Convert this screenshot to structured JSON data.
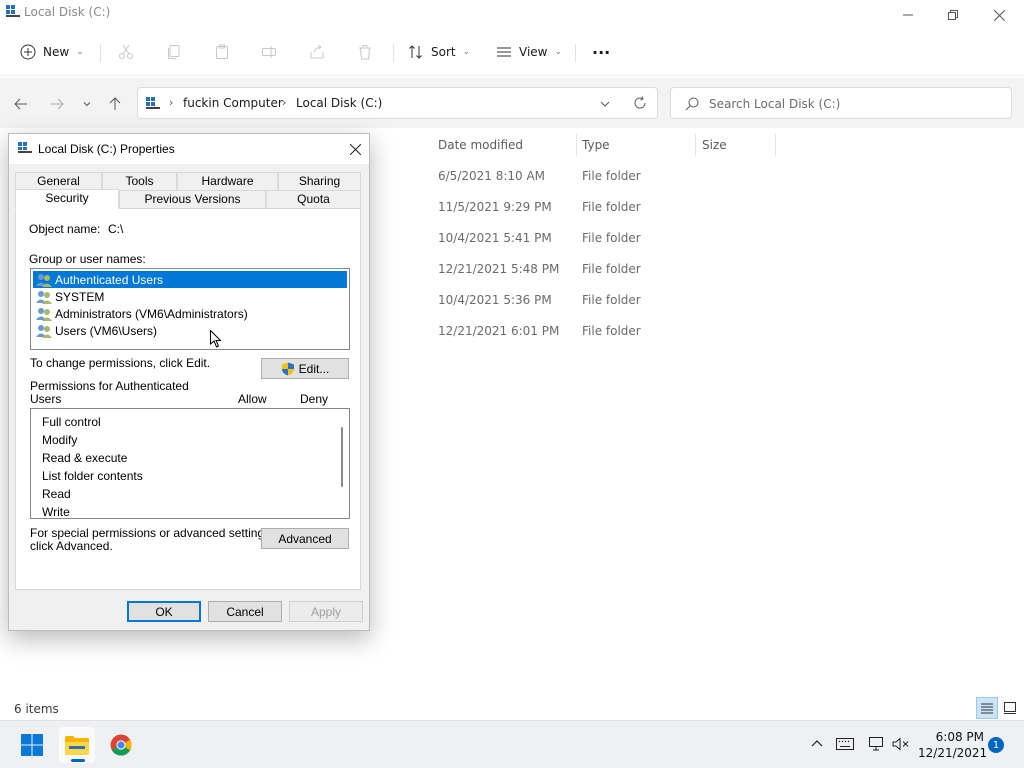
{
  "explorer": {
    "title": "Local Disk (C:)",
    "toolbar": {
      "new_label": "New",
      "sort_label": "Sort",
      "view_label": "View",
      "more_label": "···"
    },
    "address": {
      "root": "fuckin Computer",
      "current": "Local Disk (C:)"
    },
    "search": {
      "placeholder": "Search Local Disk (C:)"
    },
    "columns": {
      "date": "Date modified",
      "type": "Type",
      "size": "Size"
    },
    "files": [
      {
        "date": "6/5/2021 8:10 AM",
        "type": "File folder"
      },
      {
        "date": "11/5/2021 9:29 PM",
        "type": "File folder"
      },
      {
        "date": "10/4/2021 5:41 PM",
        "type": "File folder"
      },
      {
        "date": "12/21/2021 5:48 PM",
        "type": "File folder"
      },
      {
        "date": "10/4/2021 5:36 PM",
        "type": "File folder"
      },
      {
        "date": "12/21/2021 6:01 PM",
        "type": "File folder"
      }
    ],
    "status": {
      "item_count": "6 items"
    }
  },
  "dialog": {
    "title": "Local Disk (C:) Properties",
    "tabs_row1": [
      "General",
      "Tools",
      "Hardware",
      "Sharing"
    ],
    "tabs_row2": [
      "Security",
      "Previous Versions",
      "Quota"
    ],
    "active_tab": "Security",
    "object_name_label": "Object name:",
    "object_name_value": "C:\\",
    "group_label": "Group or user names:",
    "groups": [
      "Authenticated Users",
      "SYSTEM",
      "Administrators (VM6\\Administrators)",
      "Users (VM6\\Users)"
    ],
    "selected_group": "Authenticated Users",
    "change_text": "To change permissions, click Edit.",
    "edit_label": "Edit...",
    "permissions_label_line1": "Permissions for Authenticated",
    "permissions_label_line2": "Users",
    "allow_label": "Allow",
    "deny_label": "Deny",
    "permissions": [
      "Full control",
      "Modify",
      "Read & execute",
      "List folder contents",
      "Read",
      "Write"
    ],
    "advanced_text_line1": "For special permissions or advanced settings,",
    "advanced_text_line2": "click Advanced.",
    "advanced_label": "Advanced",
    "ok_label": "OK",
    "cancel_label": "Cancel",
    "apply_label": "Apply"
  },
  "taskbar": {
    "time": "6:08 PM",
    "date": "12/21/2021",
    "notification_count": "1"
  },
  "colors": {
    "accent": "#0078d7",
    "selection": "#0078d7",
    "taskbar_bg": "#eef0f3"
  }
}
